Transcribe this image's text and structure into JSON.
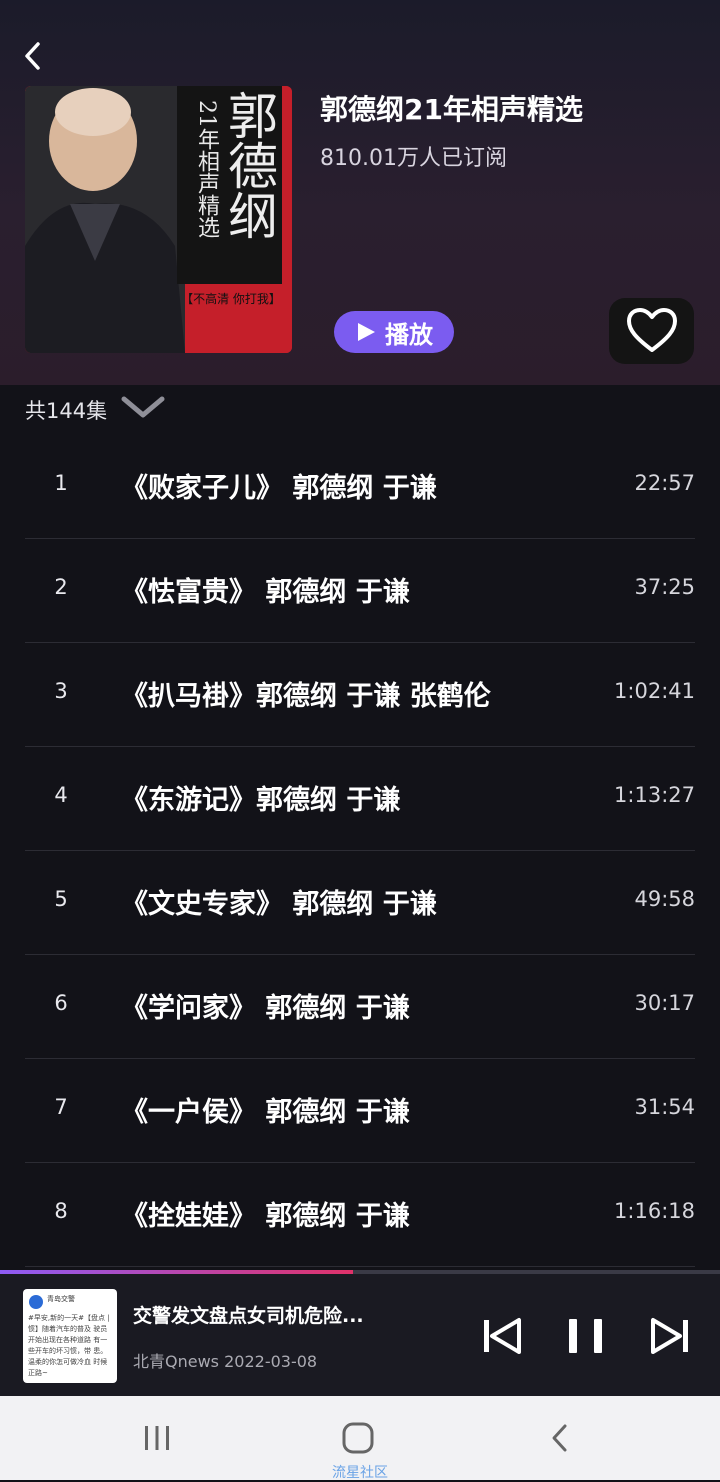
{
  "album": {
    "title": "郭德纲21年相声精选",
    "subscribers": "810.01万人已订阅",
    "play_label": "播放",
    "cover": {
      "big_name": "郭德纲",
      "subtitle": "21年相声精选",
      "tagline": "【不高清 你打我】"
    }
  },
  "episodes": {
    "count_label": "共144集",
    "items": [
      {
        "num": "1",
        "name": "《败家子儿》 郭德纲 于谦",
        "duration": "22:57"
      },
      {
        "num": "2",
        "name": "《怯富贵》 郭德纲 于谦",
        "duration": "37:25"
      },
      {
        "num": "3",
        "name": "《扒马褂》郭德纲 于谦 张鹤伦",
        "duration": "1:02:41"
      },
      {
        "num": "4",
        "name": "《东游记》郭德纲 于谦",
        "duration": "1:13:27"
      },
      {
        "num": "5",
        "name": "《文史专家》 郭德纲 于谦",
        "duration": "49:58"
      },
      {
        "num": "6",
        "name": "《学问家》 郭德纲 于谦",
        "duration": "30:17"
      },
      {
        "num": "7",
        "name": "《一户侯》 郭德纲 于谦",
        "duration": "31:54"
      },
      {
        "num": "8",
        "name": "《拴娃娃》 郭德纲 于谦",
        "duration": "1:16:18"
      }
    ]
  },
  "player": {
    "progress": 0.49,
    "title": "交警发文盘点女司机危险...",
    "source": "北青Qnews",
    "date": "2022-03-08",
    "thumb_account": "青岛交警",
    "thumb_text": "#早安,新的一天#【盘点 | 惯】随着汽车的普及 驶员开始出现在各种道路 有一些开车的坏习惯，带 患。温柔的你怎可做冷血 时候正路~"
  },
  "navbar": {
    "label": "流星社区"
  },
  "colors": {
    "accent": "#7b5cf0",
    "progress_start": "#8e5cf5",
    "progress_end": "#e0326a",
    "cover_red": "#c51f2a"
  }
}
